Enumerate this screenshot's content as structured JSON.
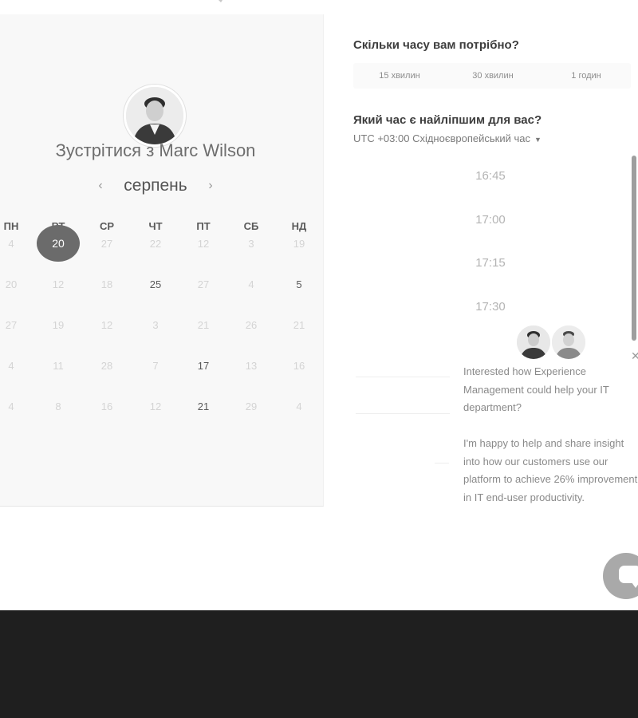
{
  "calendar": {
    "title": "Зустрітися з Marc Wilson",
    "month": "серпень",
    "prev_icon": "chevron-left-icon",
    "next_icon": "chevron-right-icon",
    "weekdays": [
      "ПН",
      "ВТ",
      "СР",
      "ЧТ",
      "ПТ",
      "СБ",
      "НД"
    ],
    "weeks": [
      [
        "4",
        "20",
        "27",
        "22",
        "12",
        "3",
        "19"
      ],
      [
        "20",
        "12",
        "18",
        "25",
        "27",
        "4",
        "5"
      ],
      [
        "27",
        "19",
        "12",
        "3",
        "21",
        "26",
        "21"
      ],
      [
        "4",
        "11",
        "28",
        "7",
        "17",
        "13",
        "16"
      ],
      [
        "4",
        "8",
        "16",
        "12",
        "21",
        "29",
        "4"
      ]
    ],
    "selected_day": "20",
    "available_days": [
      "25",
      "5",
      "17",
      "21"
    ]
  },
  "duration": {
    "question": "Скільки часу вам потрібно?",
    "options": [
      "15 хвилин",
      "30 хвилин",
      "1 годин"
    ]
  },
  "time": {
    "question": "Який час є найліпшим для вас?",
    "timezone": "UTC +03:00 Східноєвропейський час",
    "slots": [
      "16:45",
      "17:00",
      "17:15",
      "17:30"
    ]
  },
  "chat": {
    "paragraph1": "Interested how Experience Management could help your IT department?",
    "paragraph2": "I'm happy to help and share insight into how our customers use our platform to achieve 26% improvement in IT end-user productivity.",
    "close_icon": "close-icon",
    "launcher_icon": "chat-bubble-icon"
  },
  "colors": {
    "selected_day_bg": "#6b6b6b",
    "footer_bg": "#1f1f1f",
    "panel_bg": "#f8f8f8"
  }
}
